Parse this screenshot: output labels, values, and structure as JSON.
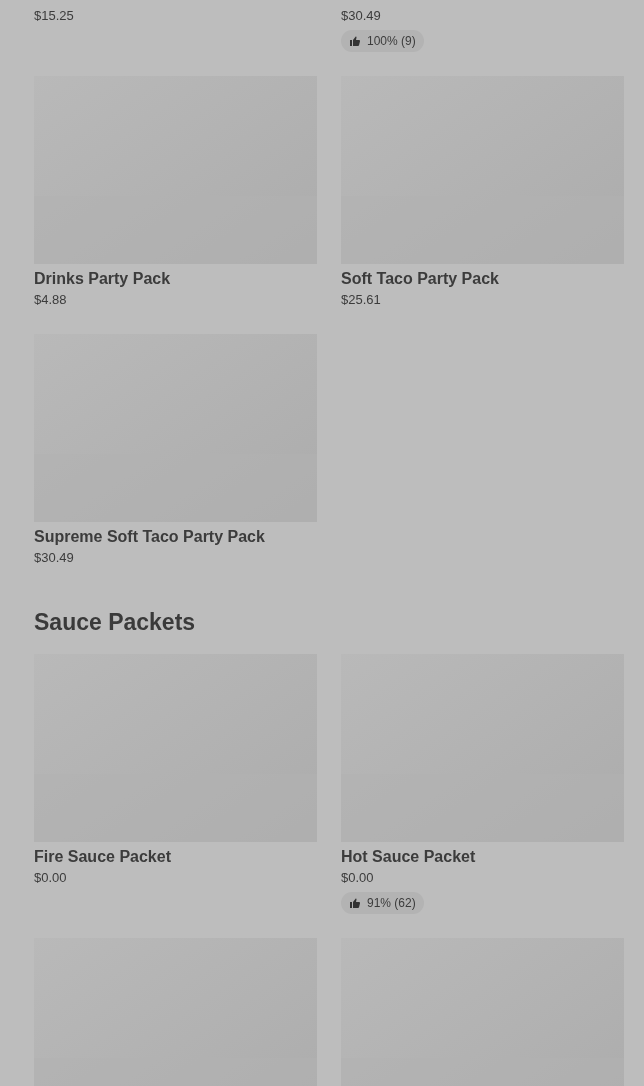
{
  "sections": [
    {
      "products": [
        {
          "kind": "product",
          "picture": false,
          "price": "$15.25"
        },
        {
          "kind": "product",
          "picture": false,
          "price": "$30.49",
          "rating": "100% (9)"
        },
        {
          "kind": "product",
          "picture": true,
          "name": "Drinks Party Pack",
          "price": "$4.88"
        },
        {
          "kind": "product",
          "picture": true,
          "name": "Soft Taco Party Pack",
          "price": "$25.61"
        },
        {
          "kind": "product",
          "picture": true,
          "name": "Supreme Soft Taco Party Pack",
          "price": "$30.49"
        }
      ]
    },
    {
      "title": "Sauce Packets",
      "products": [
        {
          "kind": "product",
          "picture": true,
          "name": "Fire Sauce Packet",
          "price": "$0.00"
        },
        {
          "kind": "product",
          "picture": true,
          "name": "Hot Sauce Packet",
          "price": "$0.00",
          "rating": "91% (62)"
        },
        {
          "kind": "product",
          "picture": true
        },
        {
          "kind": "product",
          "picture": true
        }
      ]
    }
  ]
}
